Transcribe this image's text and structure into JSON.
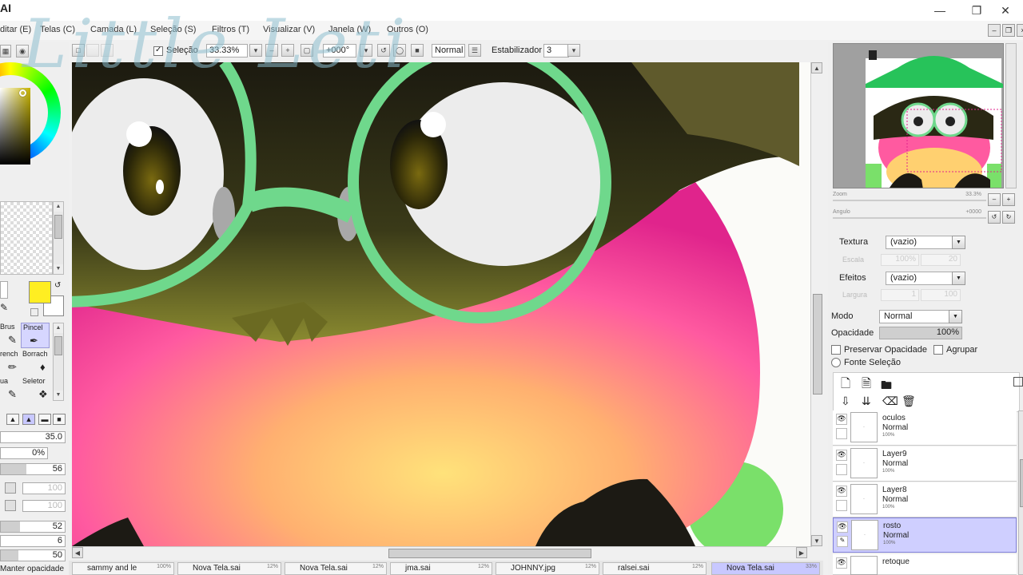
{
  "window": {
    "app_short": "AI",
    "minimize_icon": "minimize-icon",
    "restore_icon": "restore-icon",
    "close_icon": "close-icon"
  },
  "menu": [
    {
      "label": "ditar (E)"
    },
    {
      "label": "Telas (C)"
    },
    {
      "label": "Camada (L)"
    },
    {
      "label": "Seleção (S)"
    },
    {
      "label": "Filtros (T)"
    },
    {
      "label": "Visualizar (V)"
    },
    {
      "label": "Janela (W)"
    },
    {
      "label": "Outros (O)"
    }
  ],
  "toolbar": {
    "selection_label": "Seleção",
    "selection_checked": true,
    "zoom": "33.33%",
    "rotation": "+000°",
    "blend_mode": "Normal",
    "stabilizer_label": "Estabilizador",
    "stabilizer_value": "3"
  },
  "watermark": "Little Leti",
  "tools": {
    "row1": [
      {
        "label": "Brus"
      },
      {
        "label": "Pincel",
        "selected": true
      }
    ],
    "row2": [
      {
        "label": "rench"
      },
      {
        "label": "Borrach"
      }
    ],
    "row3": [
      {
        "label": "ua"
      },
      {
        "label": "Seletor"
      }
    ]
  },
  "brush_settings": {
    "size": "35.0",
    "min_size": "0%",
    "density": "56",
    "param_a": "100",
    "param_b": "100",
    "param_c": "52",
    "param_d": "6",
    "param_e": "50",
    "maintain_opacity": "Manter opacidade"
  },
  "colors": {
    "foreground": "#ffee22",
    "background": "#ffffff",
    "accent": "#c8c8ff"
  },
  "navigator": {
    "zoom_label": "Zoom",
    "zoom_value": "33.3%",
    "angle_label": "Angulo",
    "angle_value": "+0000"
  },
  "properties": {
    "texture_label": "Textura",
    "texture_value": "(vazio)",
    "scale_label": "Escala",
    "scale_value": "100%",
    "scale_num": "20",
    "effects_label": "Efeitos",
    "effects_value": "(vazio)",
    "width_label": "Largura",
    "width_value": "1",
    "width_num": "100",
    "mode_label": "Modo",
    "mode_value": "Normal",
    "opacity_label": "Opacidade",
    "opacity_value": "100%",
    "preserve_opacity": "Preservar Opacidade",
    "group_label": "Agrupar",
    "selection_source": "Fonte Seleção"
  },
  "layers": [
    {
      "name": "oculos",
      "mode": "Normal",
      "opacity": "100%",
      "selected": false
    },
    {
      "name": "Layer9",
      "mode": "Normal",
      "opacity": "100%",
      "selected": false
    },
    {
      "name": "Layer8",
      "mode": "Normal",
      "opacity": "100%",
      "selected": false
    },
    {
      "name": "rosto",
      "mode": "Normal",
      "opacity": "100%",
      "selected": true
    },
    {
      "name": "retoque",
      "mode": "",
      "opacity": "",
      "selected": false
    }
  ],
  "canvas_tabs": [
    {
      "label": "sammy and le",
      "pct": "100%"
    },
    {
      "label": "Nova Tela.sai",
      "pct": "12%"
    },
    {
      "label": "Nova Tela.sai",
      "pct": "12%"
    },
    {
      "label": "jma.sai",
      "pct": "12%"
    },
    {
      "label": "JOHNNY.jpg",
      "pct": "12%"
    },
    {
      "label": "ralsei.sai",
      "pct": "12%"
    },
    {
      "label": "Nova Tela.sai",
      "pct": "33%",
      "active": true
    }
  ]
}
